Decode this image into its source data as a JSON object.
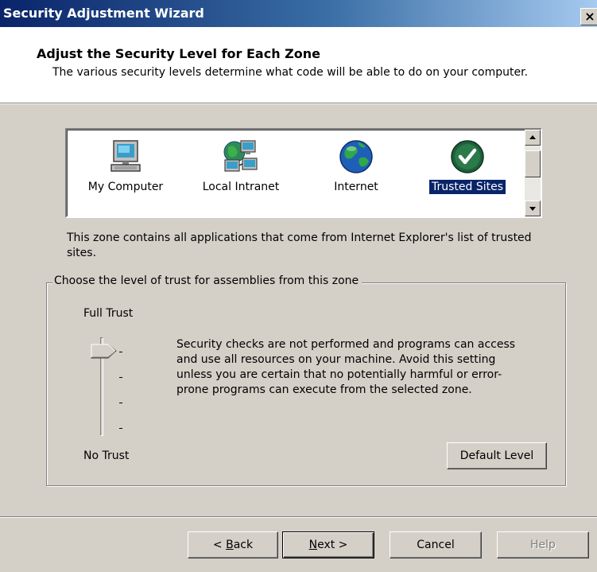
{
  "window": {
    "title": "Security Adjustment Wizard",
    "close_glyph": "×"
  },
  "header": {
    "title": "Adjust the Security Level for Each Zone",
    "subtitle": "The various security levels determine what code will be able to do on your computer."
  },
  "zones": [
    {
      "label": "My Computer",
      "icon": "computer-icon",
      "selected": false
    },
    {
      "label": "Local Intranet",
      "icon": "network-icon",
      "selected": false
    },
    {
      "label": "Internet",
      "icon": "globe-icon",
      "selected": false
    },
    {
      "label": "Trusted Sites",
      "icon": "checkmark-icon",
      "selected": true
    }
  ],
  "zone_description": "This zone contains all applications that come from Internet Explorer's list of trusted sites.",
  "trust_group": {
    "legend": "Choose the level of trust for assemblies from this zone",
    "top_label": "Full Trust",
    "bottom_label": "No Trust",
    "level_description": "Security checks are not performed and programs can access and use all resources on your machine.  Avoid this setting unless you are certain that no potentially harmful or error-prone programs can execute from the selected zone.",
    "default_level_button": "Default Level",
    "slider_levels": 4,
    "slider_selected_level": "Full Trust"
  },
  "buttons": {
    "back_prefix": "< ",
    "back_mnemonic": "B",
    "back_rest": "ack",
    "next_mnemonic": "N",
    "next_rest": "ext >",
    "cancel": "Cancel",
    "help": "Help"
  },
  "colors": {
    "selection": "#0a246a",
    "face": "#d4d0c8"
  }
}
